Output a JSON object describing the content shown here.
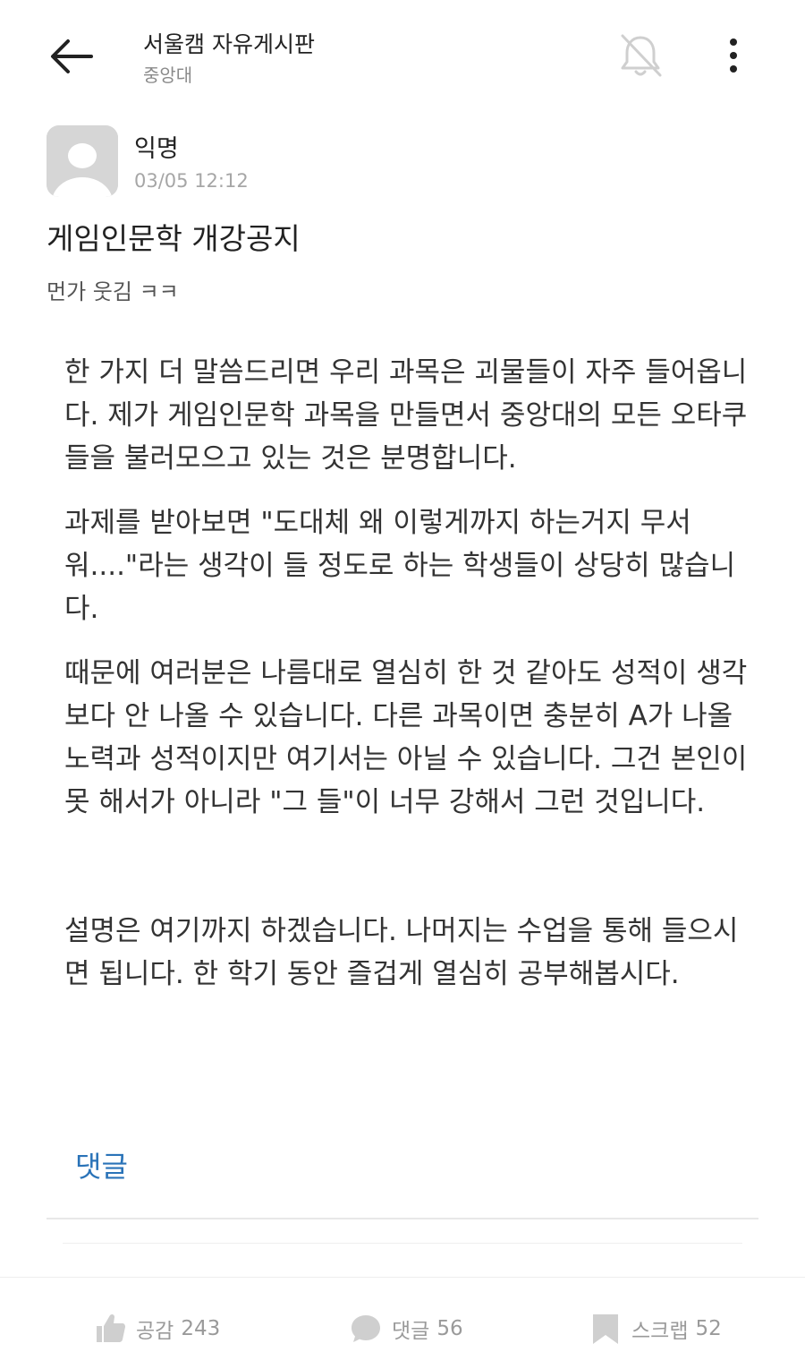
{
  "header": {
    "board_title": "서울캠 자유게시판",
    "school": "중앙대",
    "back_icon": "arrow-left-icon",
    "notification_icon": "bell-off-icon",
    "more_icon": "more-vertical-icon"
  },
  "post": {
    "author": "익명",
    "date": "03/05 12:12",
    "title": "게임인문학 개강공지",
    "subtitle": "먼가 웃김 ㅋㅋ",
    "paragraphs": [
      "한 가지 더 말씀드리면 우리 과목은 괴물들이 자주 들어옵니다. 제가 게임인문학 과목을 만들면서 중앙대의 모든 오타쿠들을 불러모으고 있는 것은 분명합니다.",
      "과제를 받아보면 \"도대체 왜 이렇게까지 하는거지 무서워....\"라는 생각이 들 정도로 하는 학생들이 상당히 많습니다.",
      "때문에 여러분은 나름대로 열심히 한 것 같아도 성적이 생각보다 안 나올 수 있습니다. 다른 과목이면 충분히 A가 나올 노력과 성적이지만 여기서는 아닐 수 있습니다. 그건 본인이 못 해서가 아니라 \"그 들\"이 너무 강해서 그런 것입니다.",
      "설명은 여기까지 하겠습니다. 나머지는 수업을 통해 들으시면 됩니다. 한 학기 동안 즐겁게 열심히 공부해봅시다."
    ],
    "comment_link": "댓글"
  },
  "actions": {
    "like_label": "공감",
    "like_count": "243",
    "comment_label": "댓글",
    "comment_count": "56",
    "scrap_label": "스크랩",
    "scrap_count": "52"
  },
  "colors": {
    "link": "#2a73b8",
    "muted": "#9a9a9a",
    "avatar_bg": "#d6d6d6"
  }
}
